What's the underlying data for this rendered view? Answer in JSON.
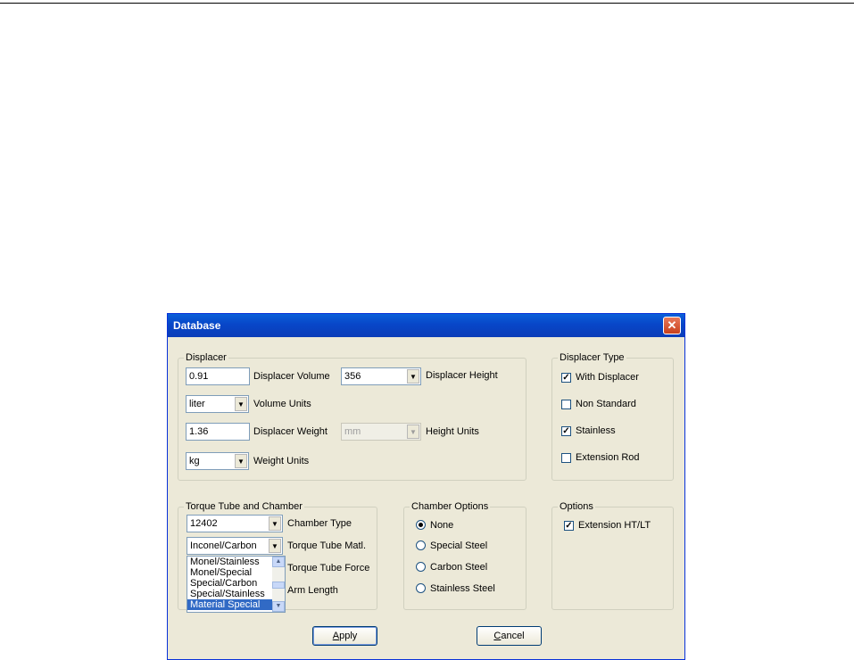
{
  "window": {
    "title": "Database"
  },
  "displacer": {
    "legend": "Displacer",
    "volume": {
      "value": "0.91",
      "label": "Displacer Volume"
    },
    "height": {
      "value": "356",
      "label": "Displacer Height"
    },
    "volume_units": {
      "value": "liter",
      "label": "Volume Units"
    },
    "weight": {
      "value": "1.36",
      "label": "Displacer Weight"
    },
    "height_units": {
      "value": "mm",
      "label": "Height Units"
    },
    "weight_units": {
      "value": "kg",
      "label": "Weight Units"
    }
  },
  "displacer_type": {
    "legend": "Displacer Type",
    "items": [
      {
        "label": "With Displacer",
        "checked": true
      },
      {
        "label": "Non Standard",
        "checked": false
      },
      {
        "label": "Stainless",
        "checked": true
      },
      {
        "label": "Extension Rod",
        "checked": false
      }
    ]
  },
  "torque": {
    "legend": "Torque Tube and Chamber",
    "chamber_type": {
      "value": "12402",
      "label": "Chamber Type"
    },
    "tube_matl": {
      "value": "Inconel/Carbon",
      "label": "Torque Tube Matl."
    },
    "tube_force_label": "Torque Tube Force",
    "arm_length_label": "Arm Length",
    "dropdown_options": [
      "Monel/Stainless",
      "Monel/Special",
      "Special/Carbon",
      "Special/Stainless",
      "Material Special"
    ],
    "selected_option": "Material Special"
  },
  "chamber_options": {
    "legend": "Chamber Options",
    "items": [
      {
        "label": "None",
        "selected": true
      },
      {
        "label": "Special Steel",
        "selected": false
      },
      {
        "label": "Carbon Steel",
        "selected": false
      },
      {
        "label": "Stainless Steel",
        "selected": false
      }
    ]
  },
  "options": {
    "legend": "Options",
    "items": [
      {
        "label": "Extension HT/LT",
        "checked": true
      }
    ]
  },
  "buttons": {
    "apply": "Apply",
    "cancel": "Cancel"
  }
}
